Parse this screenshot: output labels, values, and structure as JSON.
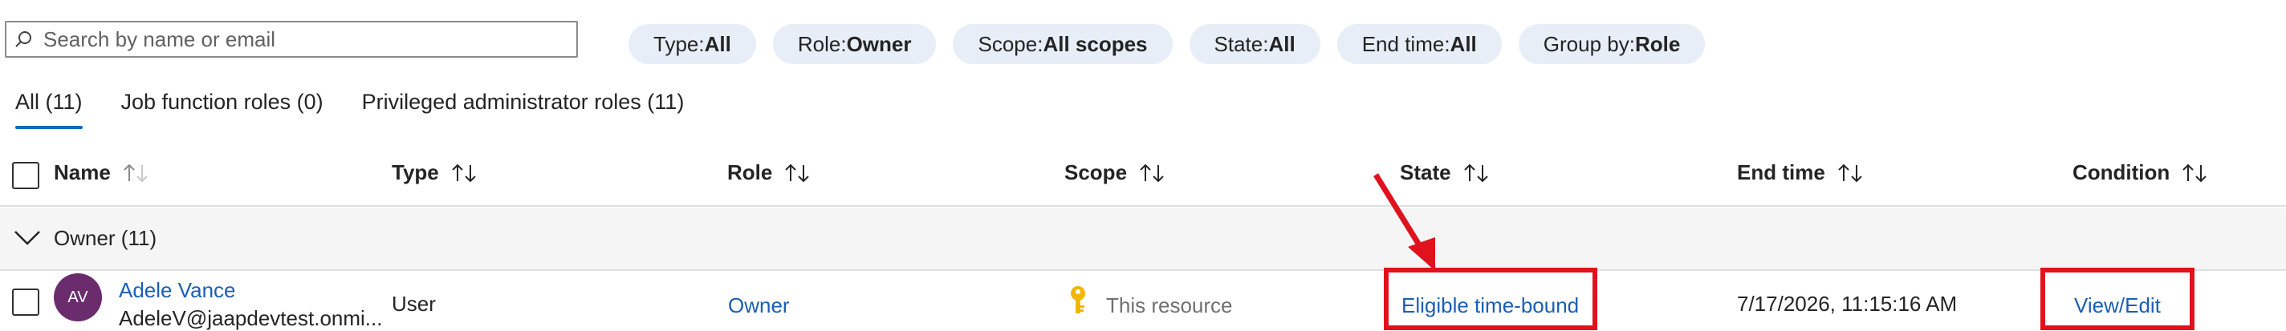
{
  "search": {
    "placeholder": "Search by name or email",
    "value": ""
  },
  "filters": [
    {
      "key": "Type",
      "value": "All"
    },
    {
      "key": "Role",
      "value": "Owner"
    },
    {
      "key": "Scope",
      "value": "All scopes"
    },
    {
      "key": "State",
      "value": "All"
    },
    {
      "key": "End time",
      "value": "All"
    },
    {
      "key": "Group by",
      "value": "Role"
    }
  ],
  "filter_sep": " : ",
  "tabs": [
    {
      "label": "All (11)",
      "active": true
    },
    {
      "label": "Job function roles (0)",
      "active": false
    },
    {
      "label": "Privileged administrator roles (11)",
      "active": false
    }
  ],
  "columns": {
    "name": "Name",
    "type": "Type",
    "role": "Role",
    "scope": "Scope",
    "state": "State",
    "end_time": "End time",
    "condition": "Condition"
  },
  "group": {
    "label": "Owner (11)"
  },
  "row": {
    "avatar_initials": "AV",
    "name": "Adele Vance",
    "email": "AdeleV@jaapdevtest.onmi...",
    "type": "User",
    "role": "Owner",
    "scope": "This resource",
    "state": "Eligible time-bound",
    "end_time": "7/17/2026, 11:15:16 AM",
    "condition": "View/Edit"
  },
  "colors": {
    "link": "#1a5fb4",
    "highlight": "#e0121e",
    "avatar": "#6b2c6e",
    "pill_bg": "#e8eef7",
    "tab_accent": "#0f6cbd",
    "key_icon": "#f2b705"
  }
}
